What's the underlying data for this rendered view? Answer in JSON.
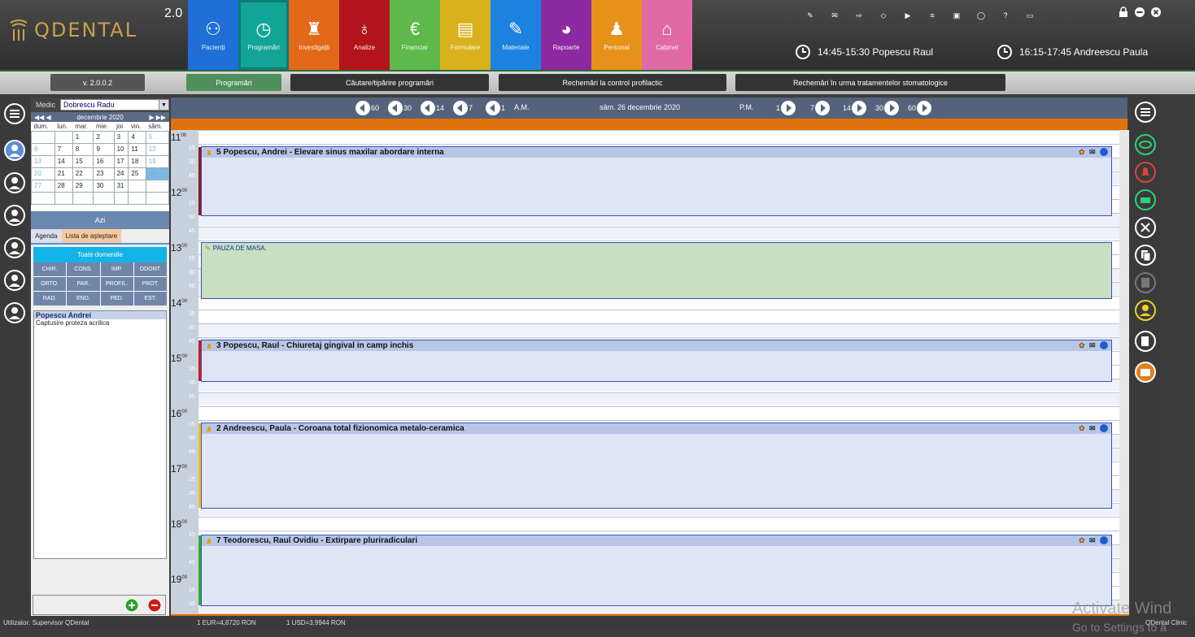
{
  "app": {
    "name": "QDENTAL",
    "version": "2.0"
  },
  "modules": [
    {
      "label": "Pacienți",
      "color": "#1f6fd6",
      "icon": "patients-icon"
    },
    {
      "label": "Programări",
      "color": "#12a597",
      "icon": "clock-icon"
    },
    {
      "label": "Investigații",
      "color": "#e3691a",
      "icon": "tooth-icon"
    },
    {
      "label": "Analize",
      "color": "#b3141c",
      "icon": "flask-icon"
    },
    {
      "label": "Financiar",
      "color": "#5fb84a",
      "icon": "euro-icon"
    },
    {
      "label": "Formulare",
      "color": "#d9b11d",
      "icon": "form-icon"
    },
    {
      "label": "Materiale",
      "color": "#1c82e0",
      "icon": "syringe-icon"
    },
    {
      "label": "Rapoarte",
      "color": "#8e2aa1",
      "icon": "pie-chart-icon"
    },
    {
      "label": "Personal",
      "color": "#e6921a",
      "icon": "staff-icon"
    },
    {
      "label": "Cabinet",
      "color": "#e06aa5",
      "icon": "home-icon"
    }
  ],
  "next_appointments": [
    {
      "text": "14:45-15:30 Popescu Raul"
    },
    {
      "text": "16:15-17:45 Andreescu Paula"
    }
  ],
  "tabs": {
    "version": "v. 2.0.0.2",
    "programari": "Programări",
    "cautare": "Căutare/tipărire programări",
    "rechemari_profilactic": "Rechemări la control profilactic",
    "rechemari_tratament": "Rechemări în urma tratamentelor stomatologice"
  },
  "medic": {
    "label": "Medic",
    "value": "Dobrescu Radu"
  },
  "calendar": {
    "month": "decembrie 2020",
    "weekdays": [
      "dum.",
      "lun.",
      "mar.",
      "mie.",
      "joi",
      "vin.",
      "sâm."
    ],
    "weeks": [
      [
        "",
        "",
        "1",
        "2",
        "3",
        "4",
        "5"
      ],
      [
        "6",
        "7",
        "8",
        "9",
        "10",
        "11",
        "12"
      ],
      [
        "13",
        "14",
        "15",
        "16",
        "17",
        "18",
        "19"
      ],
      [
        "20",
        "21",
        "22",
        "23",
        "24",
        "25",
        "26"
      ],
      [
        "27",
        "28",
        "29",
        "30",
        "31",
        "",
        ""
      ],
      [
        "",
        "",
        "",
        "",
        "",
        "",
        ""
      ]
    ],
    "selected": "26"
  },
  "azi": "Azi",
  "agenda_tabs": {
    "agenda": "Agenda",
    "waitlist": "Lista de așteptare"
  },
  "domains": {
    "all": "Toate domeniile",
    "items": [
      "CHIR.",
      "CONS.",
      "IMP.",
      "ODONT.",
      "ORTO.",
      "PAR.",
      "PROFIL.",
      "PROT.",
      "RAD.",
      "END.",
      "PED.",
      "EST."
    ]
  },
  "waitlist": [
    {
      "name": "Popescu Andrei",
      "detail": "Captusire proteza acrilica"
    }
  ],
  "datenav": {
    "back": [
      "60",
      "30",
      "14",
      "7",
      "1"
    ],
    "am": "A.M.",
    "date": "sâm. 26 decembrie 2020",
    "pm": "P.M.",
    "fwd": [
      "1",
      "7",
      "14",
      "30",
      "60"
    ]
  },
  "hours": [
    "11",
    "12",
    "13",
    "14",
    "15",
    "16",
    "17",
    "18",
    "19"
  ],
  "appointments": [
    {
      "title": "5 Popescu, Andrei - Elevare sinus maxilar abordare interna",
      "color": "#b8c6e6",
      "bell": true
    },
    {
      "title": "PAUZA DE MASA.",
      "color": "#c6e0c0",
      "bell": false
    },
    {
      "title": "3 Popescu, Raul - Chiuretaj gingival in camp inchis",
      "color": "#b8c6e6",
      "bell": true
    },
    {
      "title": "2 Andreescu, Paula - Coroana total fizionomica metalo-ceramica",
      "color": "#b8c6e6",
      "bell": true
    },
    {
      "title": "7 Teodorescu, Raul Ovidiu - Extirpare pluriradiculari",
      "color": "#b8c6e6",
      "bell": true
    }
  ],
  "status": {
    "user": "Utilizator: Supervisor QDental",
    "eur": "1 EUR=4,8720 RON",
    "usd": "1 USD=3,9944 RON",
    "brand": "QDental Clinic"
  },
  "watermark": {
    "line1": "Activate Wind",
    "line2": "Go to Settings to a"
  }
}
